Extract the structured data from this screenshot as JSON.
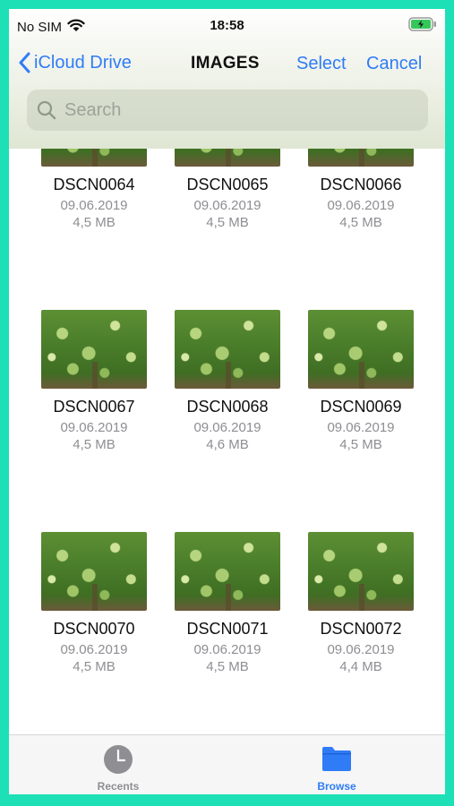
{
  "status_bar": {
    "carrier": "No SIM",
    "time": "18:58"
  },
  "nav": {
    "back_label": "iCloud Drive",
    "title": "IMAGES",
    "select_label": "Select",
    "cancel_label": "Cancel"
  },
  "search": {
    "placeholder": "Search"
  },
  "files": [
    {
      "name": "DSCN0064",
      "date": "09.06.2019",
      "size": "4,5 MB"
    },
    {
      "name": "DSCN0065",
      "date": "09.06.2019",
      "size": "4,5 MB"
    },
    {
      "name": "DSCN0066",
      "date": "09.06.2019",
      "size": "4,5 MB"
    },
    {
      "name": "DSCN0067",
      "date": "09.06.2019",
      "size": "4,5 MB"
    },
    {
      "name": "DSCN0068",
      "date": "09.06.2019",
      "size": "4,6 MB"
    },
    {
      "name": "DSCN0069",
      "date": "09.06.2019",
      "size": "4,5 MB"
    },
    {
      "name": "DSCN0070",
      "date": "09.06.2019",
      "size": "4,5 MB"
    },
    {
      "name": "DSCN0071",
      "date": "09.06.2019",
      "size": "4,5 MB"
    },
    {
      "name": "DSCN0072",
      "date": "09.06.2019",
      "size": "4,4 MB"
    }
  ],
  "tab_bar": {
    "recents_label": "Recents",
    "browse_label": "Browse"
  },
  "colors": {
    "accent": "#2f7cf6",
    "frame": "#1de0b6",
    "secondary_text": "#8e8e93"
  },
  "icons": {
    "wifi": "wifi-icon",
    "battery": "battery-charging-icon",
    "back": "chevron-left-icon",
    "search": "search-icon",
    "recents": "clock-icon",
    "browse": "folder-icon"
  }
}
